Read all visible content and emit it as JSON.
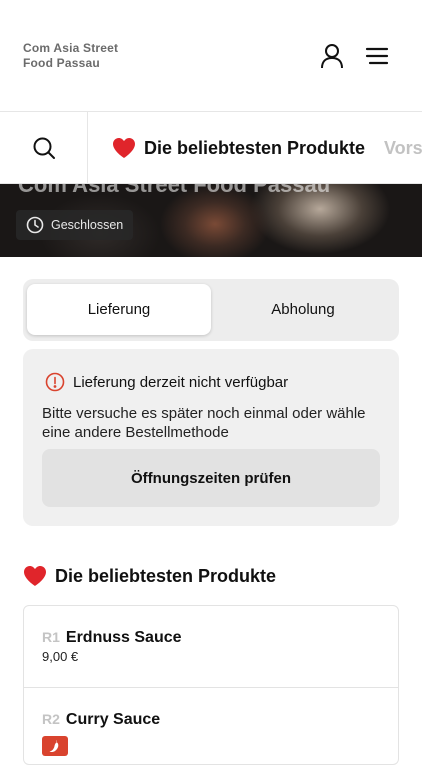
{
  "header": {
    "brand_line1": "Com Asia Street",
    "brand_line2": "Food Passau",
    "icons": {
      "user": "user-icon",
      "menu": "hamburger-menu-icon"
    }
  },
  "category_bar": {
    "search_icon": "search-icon",
    "active_tab": "Die beliebtesten Produkte",
    "active_tab_icon": "heart-icon",
    "next_tab": "Vors"
  },
  "hero": {
    "restaurant_name": "Com Asia Street Food Passau",
    "status": "Geschlossen",
    "status_icon": "clock-icon"
  },
  "order_mode": {
    "options": [
      "Lieferung",
      "Abholung"
    ],
    "selected": "Lieferung"
  },
  "notice": {
    "icon": "info-alert-icon",
    "title": "Lieferung derzeit nicht verfügbar",
    "message": "Bitte versuche es später noch einmal oder wähle eine andere Bestellmethode",
    "button": "Öffnungszeiten prüfen"
  },
  "section": {
    "title": "Die beliebtesten Produkte",
    "icon": "heart-icon"
  },
  "products": [
    {
      "code": "R1",
      "name": "Erdnuss Sauce",
      "price": "9,00 €"
    },
    {
      "code": "R2",
      "name": "Curry Sauce",
      "badge": "chili-icon"
    }
  ],
  "colors": {
    "heart": "#e0252b",
    "alert": "#d9432e",
    "muted_text": "#6b6b6b",
    "panel_bg": "#f0f0f0"
  }
}
